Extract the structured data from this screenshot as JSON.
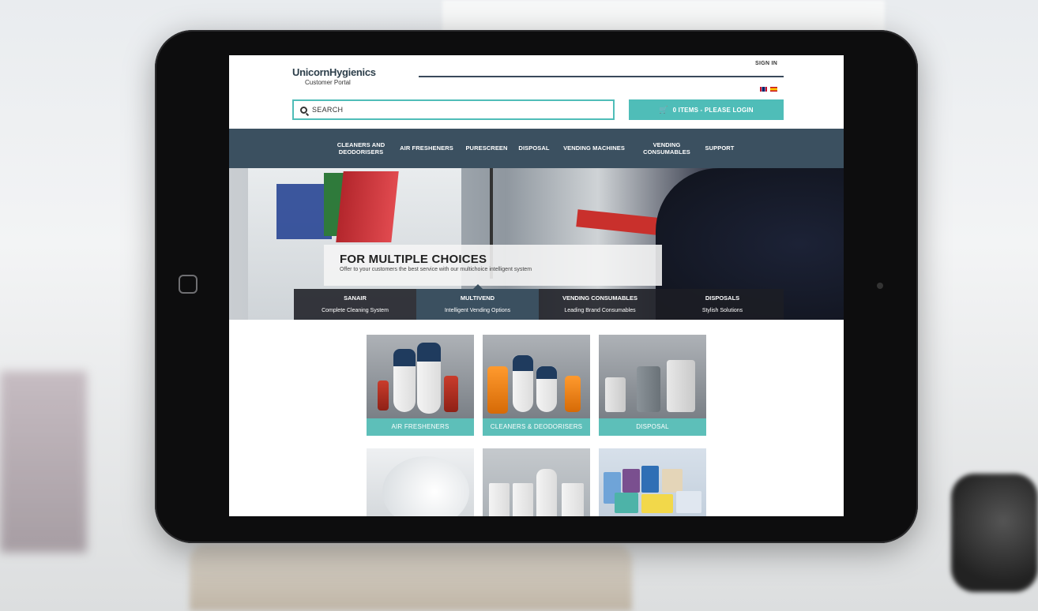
{
  "header": {
    "logo_text": "UnicornHygienics",
    "logo_sub": "Customer Portal",
    "sign_in": "SIGN IN",
    "search_placeholder": "SEARCH",
    "cart_label": "0 ITEMS - PLEASE LOGIN"
  },
  "nav": {
    "items": [
      {
        "label": "CLEANERS AND DEODORISERS"
      },
      {
        "label": "AIR FRESHENERS"
      },
      {
        "label": "PURESCREEN"
      },
      {
        "label": "DISPOSAL"
      },
      {
        "label": "VENDING MACHINES"
      },
      {
        "label": "VENDING CONSUMABLES"
      },
      {
        "label": "SUPPORT"
      }
    ]
  },
  "hero": {
    "title": "FOR MULTIPLE CHOICES",
    "subtitle": "Offer to your customers the best service with our multichoice intelligent system",
    "tabs": [
      {
        "title": "SANAIR",
        "sub": "Complete Cleaning System",
        "active": false
      },
      {
        "title": "MULTIVEND",
        "sub": "Intelligent Vending Options",
        "active": true
      },
      {
        "title": "VENDING CONSUMABLES",
        "sub": "Leading Brand Consumables",
        "active": false
      },
      {
        "title": "DISPOSALS",
        "sub": "Stylish Solutions",
        "active": false
      }
    ]
  },
  "categories": [
    {
      "label": "AIR FRESHENERS"
    },
    {
      "label": "CLEANERS & DEODORISERS"
    },
    {
      "label": "DISPOSAL"
    },
    {
      "label": ""
    },
    {
      "label": ""
    },
    {
      "label": ""
    }
  ],
  "colors": {
    "accent": "#4fbdb8",
    "nav": "#3b5060"
  },
  "icons": {
    "search": "search-icon",
    "cart": "cart-icon"
  }
}
